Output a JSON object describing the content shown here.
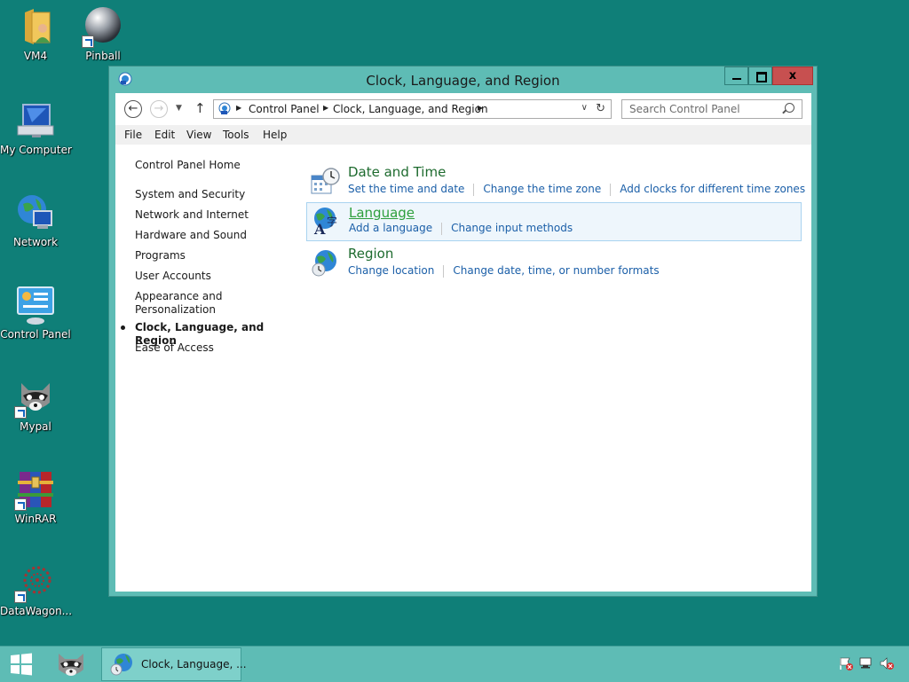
{
  "desktop": {
    "icons": [
      {
        "label": "VM4"
      },
      {
        "label": "Pinball"
      },
      {
        "label": "My Computer"
      },
      {
        "label": "Network"
      },
      {
        "label": "Control Panel"
      },
      {
        "label": "Mypal"
      },
      {
        "label": "WinRAR"
      },
      {
        "label": "DataWagon..."
      }
    ]
  },
  "window": {
    "title": "Clock, Language, and Region",
    "close_label": "x",
    "address": {
      "crumbs": [
        "Control Panel",
        "Clock, Language, and Region"
      ]
    },
    "search": {
      "placeholder": "Search Control Panel"
    },
    "menu": [
      "File",
      "Edit",
      "View",
      "Tools",
      "Help"
    ],
    "sidebar": {
      "items": [
        {
          "label": "Control Panel Home"
        },
        {
          "label": "System and Security"
        },
        {
          "label": "Network and Internet"
        },
        {
          "label": "Hardware and Sound"
        },
        {
          "label": "Programs"
        },
        {
          "label": "User Accounts"
        },
        {
          "label": "Appearance and\nPersonalization"
        },
        {
          "label": "Clock, Language, and Region",
          "current": true
        },
        {
          "label": "Ease of Access"
        }
      ]
    },
    "categories": [
      {
        "title": "Date and Time",
        "icon": "clock-calendar-icon",
        "links": [
          "Set the time and date",
          "Change the time zone",
          "Add clocks for different time zones"
        ]
      },
      {
        "title": "Language",
        "icon": "language-globe-icon",
        "links": [
          "Add a language",
          "Change input methods"
        ]
      },
      {
        "title": "Region",
        "icon": "region-globe-icon",
        "links": [
          "Change location",
          "Change date, time, or number formats"
        ]
      }
    ]
  },
  "taskbar": {
    "task_label": "Clock, Language, ..."
  },
  "colors": {
    "desktop": "#0f7f78",
    "window_frame": "#5ebcb5",
    "close_button": "#c75050",
    "category_title": "#1e6b2f",
    "link": "#1b5fa8"
  }
}
